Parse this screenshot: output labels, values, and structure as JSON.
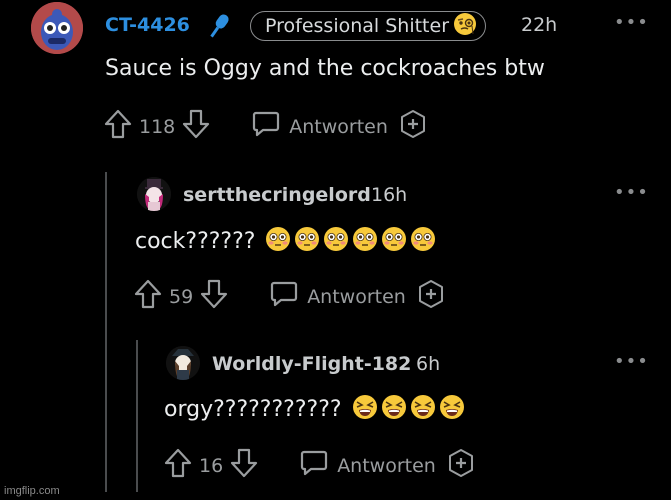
{
  "comments": [
    {
      "username": "CT-4426",
      "flair": "Professional Shitter",
      "time": "22h",
      "body": "Sauce is Oggy and the cockroaches btw",
      "votes": "118",
      "reply_label": "Antworten",
      "menu": "•••"
    },
    {
      "username": "sertthecringelord",
      "time": "16h",
      "body": "cock??????",
      "emoji_count": 6,
      "votes": "59",
      "reply_label": "Antworten",
      "menu": "•••"
    },
    {
      "username": "Worldly-Flight-182",
      "time": "6h",
      "body": "orgy???????????",
      "emoji_count": 4,
      "votes": "16",
      "reply_label": "Antworten",
      "menu": "•••"
    }
  ],
  "watermark": "imgflip.com",
  "colors": {
    "background": "#000000",
    "op_username": "#2d8fe0",
    "mic": "#2d8fe0",
    "thread_line": "#4a4c4e"
  },
  "icons": [
    "upvote-icon",
    "downvote-icon",
    "comment-bubble-icon",
    "add-award-icon",
    "microphone-icon",
    "monocle-emoji-icon",
    "flushed-emoji-icon",
    "tired-face-emoji-icon",
    "more-options-icon"
  ]
}
